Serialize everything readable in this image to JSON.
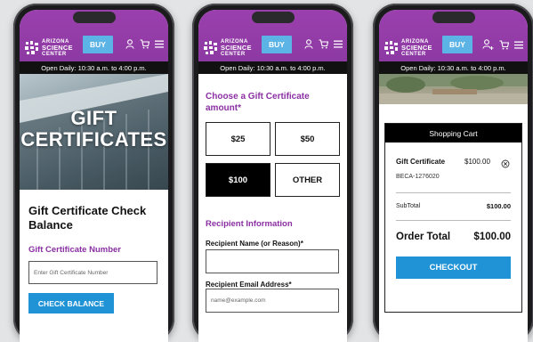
{
  "brand": {
    "logo_line1": "ARIZONA",
    "logo_line2": "SCIENCE",
    "logo_line3": "CENTER",
    "purple": "#9b3fae",
    "blue": "#1f93d5"
  },
  "header": {
    "buy_label": "BUY",
    "hours": "Open Daily: 10:30 a.m. to 4:00 p.m."
  },
  "balance_screen": {
    "hero_line1": "GIFT",
    "hero_line2": "CERTIFICATES",
    "title": "Gift Certificate Check Balance",
    "number_label": "Gift Certificate Number",
    "number_placeholder": "Enter Gift Certificate Number",
    "check_button": "CHECK BALANCE"
  },
  "purchase_screen": {
    "choose_heading": "Choose a Gift Certificate amount*",
    "amounts": [
      {
        "label": "$25",
        "selected": false
      },
      {
        "label": "$50",
        "selected": false
      },
      {
        "label": "$100",
        "selected": true
      },
      {
        "label": "OTHER",
        "selected": false
      }
    ],
    "recipient_heading": "Recipient Information",
    "name_label": "Recipient Name (or Reason)*",
    "email_label": "Recipient Email Address*",
    "email_placeholder": "name@example.com"
  },
  "cart_screen": {
    "cart_title": "Shopping Cart",
    "item_name": "Gift Certificate",
    "item_price": "$100.00",
    "item_code": "BECA-1276020",
    "subtotal_label": "SubTotal",
    "subtotal_value": "$100.00",
    "total_label": "Order Total",
    "total_value": "$100.00",
    "checkout_button": "CHECKOUT"
  }
}
